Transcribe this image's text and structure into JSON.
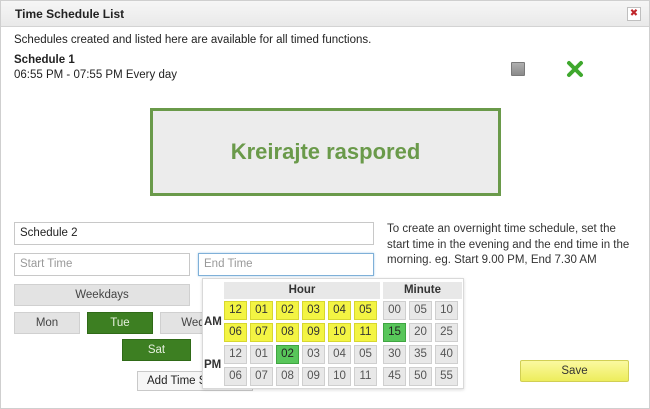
{
  "dialog": {
    "title": "Time Schedule List",
    "close_glyph": "✖",
    "intro": "Schedules created and listed here are available for all timed functions."
  },
  "schedule": {
    "name": "Schedule 1",
    "time": "06:55 PM - 07:55 PM Every day",
    "edit_icon": "edit-icon",
    "delete_icon": "delete-icon"
  },
  "create_box": {
    "label": "Kreirajte raspored"
  },
  "form": {
    "name_value": "Schedule 2",
    "start_placeholder": "Start Time",
    "end_placeholder": "End Time",
    "help": "To create an overnight time schedule, set the start time in the evening and the end time in the morning. eg. Start 9.00 PM, End 7.30 AM",
    "weekdays": "Weekdays",
    "mon": "Mon",
    "tue": "Tue",
    "wed": "Wed",
    "sat": "Sat",
    "add_button": "Add Time Schedule",
    "save_button": "Save"
  },
  "picker": {
    "hour_header": "Hour",
    "minute_header": "Minute",
    "am_label": "AM",
    "pm_label": "PM",
    "hour_rows": [
      [
        "12",
        "01",
        "02",
        "03",
        "04",
        "05"
      ],
      [
        "06",
        "07",
        "08",
        "09",
        "10",
        "11"
      ],
      [
        "12",
        "01",
        "02",
        "03",
        "04",
        "05"
      ],
      [
        "06",
        "07",
        "08",
        "09",
        "10",
        "11"
      ]
    ],
    "minute_rows": [
      [
        "00",
        "05",
        "10"
      ],
      [
        "15",
        "20",
        "25"
      ],
      [
        "30",
        "35",
        "40"
      ],
      [
        "45",
        "50",
        "55"
      ]
    ],
    "selected_hour": "02 PM",
    "selected_minute": "15"
  },
  "colors": {
    "accent_green": "#6a9a4a",
    "day_selected": "#3d7f22",
    "hour_am": "#f3f443",
    "selected_cell": "#58c65a",
    "save_button": "#eded5c"
  }
}
